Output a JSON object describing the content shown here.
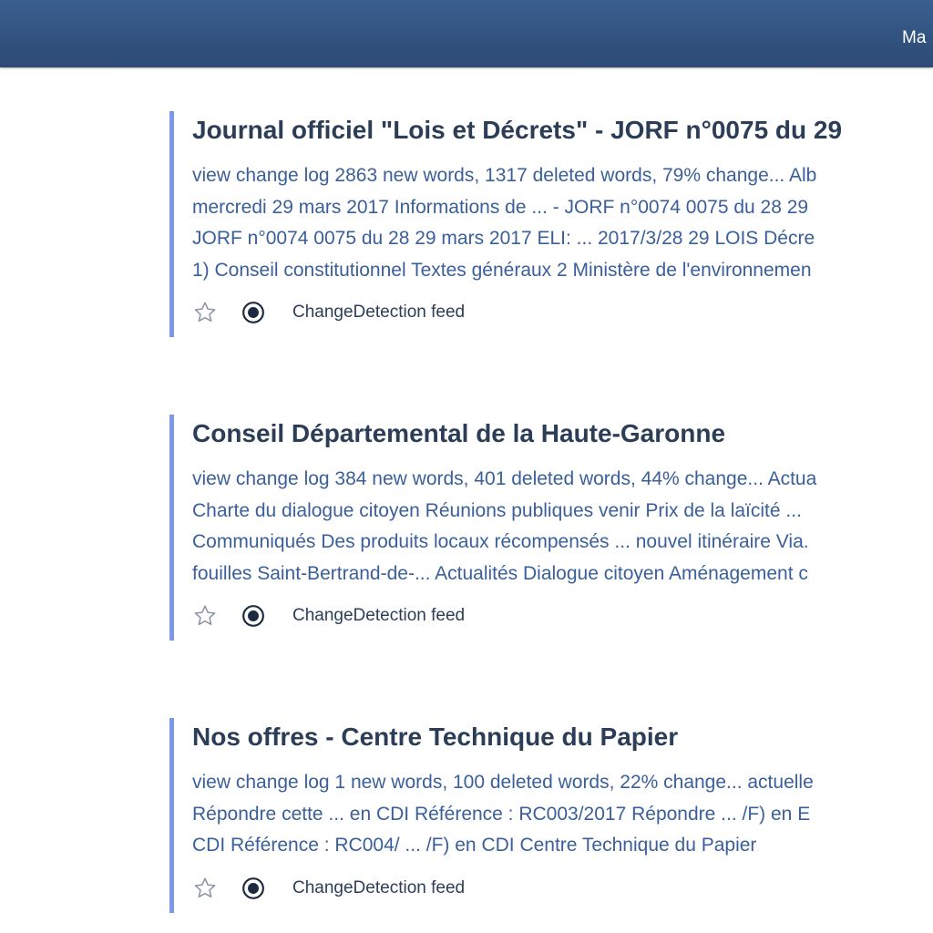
{
  "header": {
    "menu_label": "Ma"
  },
  "results": [
    {
      "title": "Journal officiel \"Lois et Décrets\" - JORF n°0075 du 29",
      "snippet_lines": [
        "view change log 2863 new words, 1317 deleted words, 79% change... Alb",
        "mercredi 29 mars 2017 Informations de ... - JORF n°0074 0075 du 28 29",
        "JORF n°0074 0075 du 28 29 mars 2017 ELI: ... 2017/3/28 29 LOIS Décre",
        "1) Conseil constitutionnel Textes généraux 2 Ministère de l'environnemen"
      ],
      "feed_label": "ChangeDetection feed"
    },
    {
      "title": "Conseil Départemental de la Haute-Garonne",
      "snippet_lines": [
        "view change log 384 new words, 401 deleted words, 44% change... Actua",
        "Charte du dialogue citoyen Réunions publiques venir Prix de la laïcité ...",
        "Communiqués Des produits locaux récompensés ... nouvel itinéraire Via.",
        "fouilles Saint-Bertrand-de-... Actualités Dialogue citoyen Aménagement c"
      ],
      "feed_label": "ChangeDetection feed"
    },
    {
      "title": "Nos offres - Centre Technique du Papier",
      "snippet_lines": [
        "view change log 1 new words, 100 deleted words, 22% change... actuelle",
        "Répondre cette ... en CDI Référence : RC003/2017 Répondre ... /F) en E",
        "CDI Référence : RC004/ ... /F) en CDI Centre Technique du Papier"
      ],
      "feed_label": "ChangeDetection feed"
    }
  ],
  "colors": {
    "header_bg": "#2f5280",
    "card_accent": "#7b98ea",
    "title_text": "#2c3e57",
    "snippet_text": "#3a5f9a"
  }
}
